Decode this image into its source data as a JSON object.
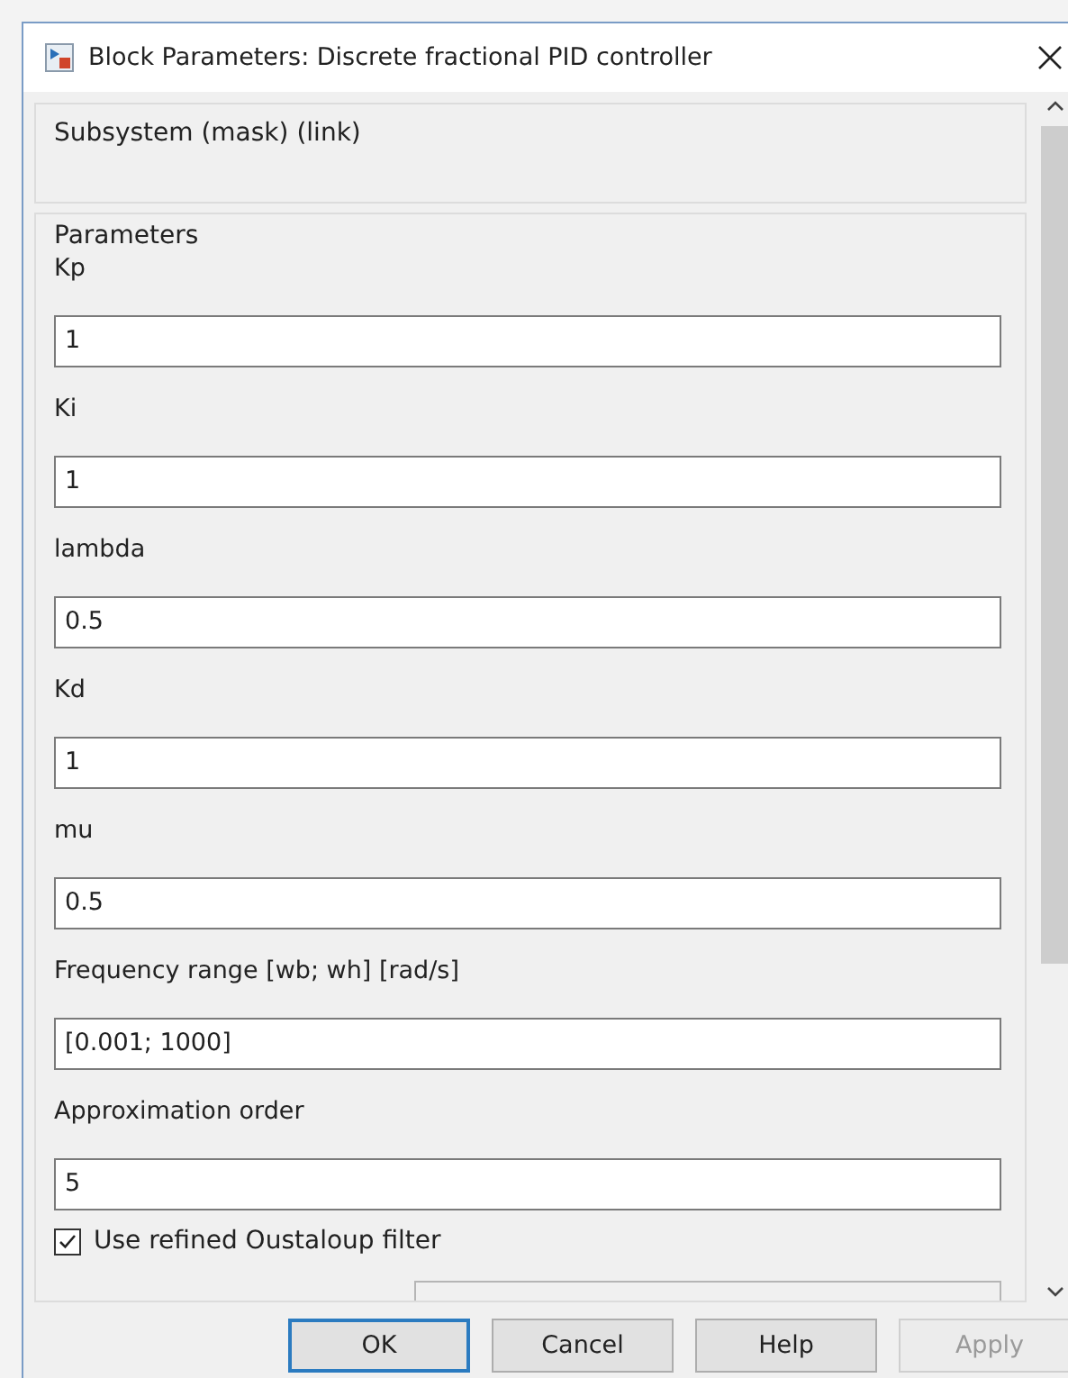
{
  "window": {
    "title": "Block Parameters: Discrete fractional PID controller"
  },
  "description_group": {
    "title": "Subsystem (mask) (link)"
  },
  "parameters_group": {
    "title": "Parameters",
    "fields": [
      {
        "label": "Kp",
        "value": "1"
      },
      {
        "label": "Ki",
        "value": "1"
      },
      {
        "label": "lambda",
        "value": "0.5"
      },
      {
        "label": "Kd",
        "value": "1"
      },
      {
        "label": "mu",
        "value": "0.5"
      },
      {
        "label": "Frequency range [wb; wh] [rad/s]",
        "value": "[0.001; 1000]"
      },
      {
        "label": "Approximation order",
        "value": "5"
      }
    ],
    "checkbox": {
      "label": "Use refined Oustaloup filter",
      "checked": true
    }
  },
  "buttons": [
    {
      "label": "OK",
      "focused": true,
      "disabled": false
    },
    {
      "label": "Cancel",
      "focused": false,
      "disabled": false
    },
    {
      "label": "Help",
      "focused": false,
      "disabled": false
    },
    {
      "label": "Apply",
      "focused": false,
      "disabled": true
    }
  ]
}
